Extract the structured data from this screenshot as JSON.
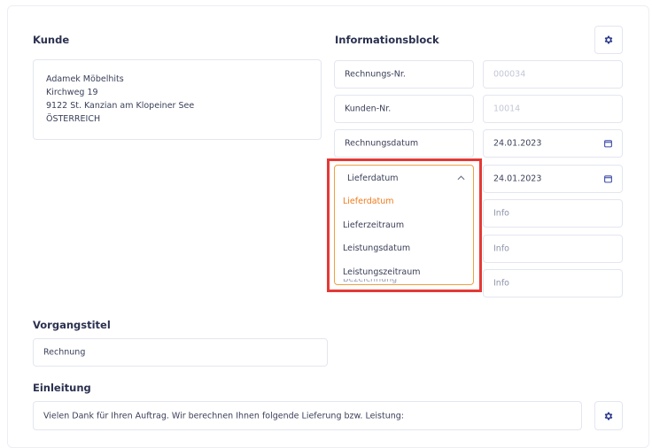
{
  "customer": {
    "heading": "Kunde",
    "address_lines": [
      "Adamek Möbelhits",
      "Kirchweg 19",
      "9122 St. Kanzian am Klopeiner See",
      "ÖSTERREICH"
    ]
  },
  "info_block": {
    "heading": "Informationsblock",
    "settings_icon": "gear-icon",
    "rows": [
      {
        "label": "Rechnungs-Nr.",
        "value": "000034"
      },
      {
        "label": "Kunden-Nr.",
        "value": "10014"
      },
      {
        "label": "Rechnungsdatum",
        "value": "24.01.2023"
      },
      {
        "label": "Lieferdatum",
        "value": "24.01.2023"
      },
      {
        "label": "",
        "value": "Info"
      },
      {
        "label": "",
        "value": "Info"
      },
      {
        "label": "Bezeichnung",
        "value": "Info"
      }
    ],
    "date_dropdown": {
      "selected": "Lieferdatum",
      "options": [
        "Lieferdatum",
        "Lieferzeitraum",
        "Leistungsdatum",
        "Leistungszeitraum"
      ],
      "active_color": "#f07a1a"
    }
  },
  "title_section": {
    "heading": "Vorgangstitel",
    "value": "Rechnung"
  },
  "intro_section": {
    "heading": "Einleitung",
    "value": "Vielen Dank für Ihren Auftrag. Wir berechnen Ihnen folgende Lieferung bzw. Leistung:",
    "settings_icon": "gear-icon"
  },
  "highlight_color": "#e53935"
}
